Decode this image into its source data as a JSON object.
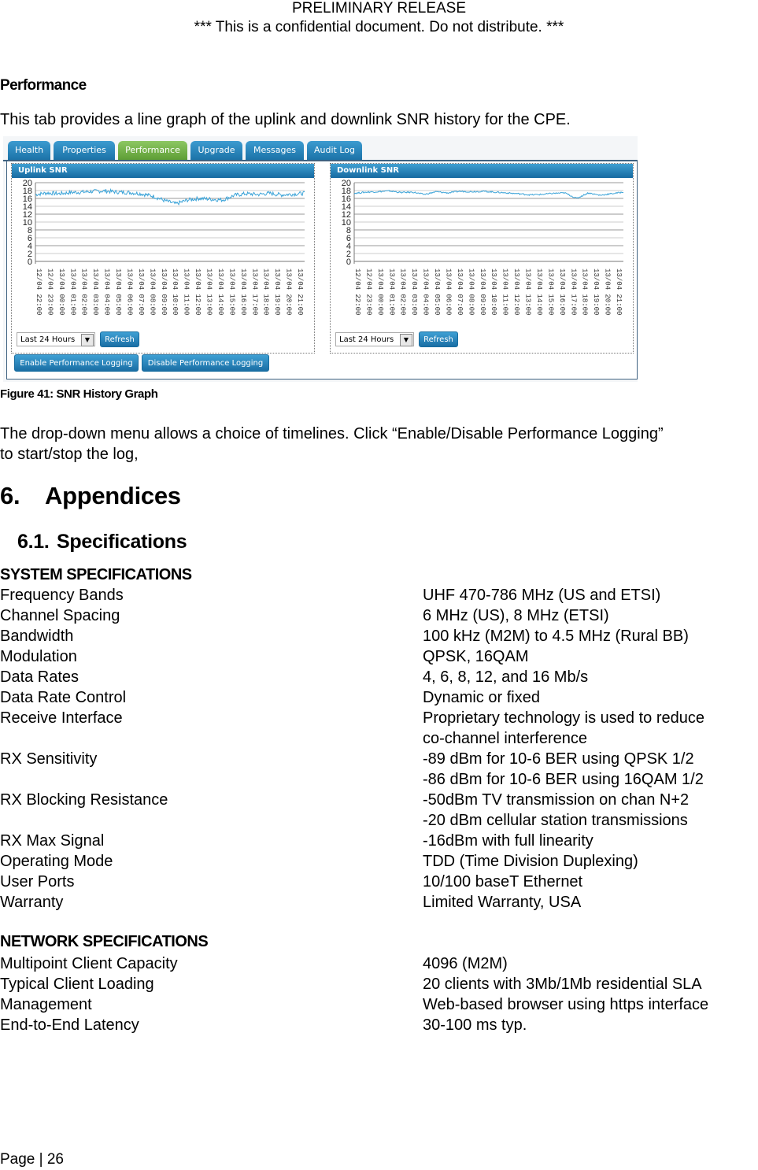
{
  "page_header": {
    "line1": "PRELIMINARY RELEASE",
    "line2": "*** This is a confidential document. Do not distribute. ***"
  },
  "performance": {
    "heading": "Performance",
    "intro": "This tab provides a line graph of the uplink and downlink SNR history for the CPE."
  },
  "screenshot": {
    "tabs": [
      {
        "label": "Health",
        "active": false
      },
      {
        "label": "Properties",
        "active": false
      },
      {
        "label": "Performance",
        "active": true
      },
      {
        "label": "Upgrade",
        "active": false
      },
      {
        "label": "Messages",
        "active": false
      },
      {
        "label": "Audit Log",
        "active": false
      }
    ],
    "panels": [
      {
        "title": "Uplink SNR",
        "range_select": "Last 24 Hours",
        "refresh_label": "Refresh"
      },
      {
        "title": "Downlink SNR",
        "range_select": "Last 24 Hours",
        "refresh_label": "Refresh"
      }
    ],
    "enable_logging_label": "Enable Performance Logging",
    "disable_logging_label": "Disable Performance Logging",
    "colors": {
      "tab_blue": "#1c73a8",
      "tab_active_green": "#5e9e35",
      "series_line": "#3aa3d8"
    }
  },
  "chart_data": [
    {
      "type": "line",
      "title": "Uplink SNR",
      "xlabel": "",
      "ylabel": "",
      "ylim": [
        0,
        20
      ],
      "yticks": [
        0,
        2,
        4,
        6,
        8,
        10,
        12,
        14,
        16,
        18,
        20
      ],
      "grid": true,
      "x": [
        "12/04 22:00",
        "12/04 23:00",
        "13/04 00:00",
        "13/04 01:00",
        "13/04 02:00",
        "13/04 03:00",
        "13/04 04:00",
        "13/04 05:00",
        "13/04 06:00",
        "13/04 07:00",
        "13/04 08:00",
        "13/04 09:00",
        "13/04 10:00",
        "13/04 11:00",
        "13/04 12:00",
        "13/04 13:00",
        "13/04 14:00",
        "13/04 15:00",
        "13/04 16:00",
        "13/04 17:00",
        "13/04 18:00",
        "13/04 19:00",
        "13/04 20:00",
        "13/04 21:00"
      ],
      "series": [
        {
          "name": "Uplink SNR",
          "values": [
            17.0,
            17.4,
            17.2,
            17.5,
            17.6,
            17.8,
            17.9,
            17.6,
            17.5,
            17.2,
            16.6,
            15.5,
            14.6,
            15.6,
            16.0,
            15.8,
            15.6,
            16.8,
            17.2,
            17.0,
            17.3,
            16.9,
            17.1,
            17.3
          ]
        }
      ]
    },
    {
      "type": "line",
      "title": "Downlink SNR",
      "xlabel": "",
      "ylabel": "",
      "ylim": [
        0,
        20
      ],
      "yticks": [
        0,
        2,
        4,
        6,
        8,
        10,
        12,
        14,
        16,
        18,
        20
      ],
      "grid": true,
      "x": [
        "12/04 22:00",
        "12/04 23:00",
        "13/04 00:00",
        "13/04 01:00",
        "13/04 02:00",
        "13/04 03:00",
        "13/04 04:00",
        "13/04 05:00",
        "13/04 06:00",
        "13/04 07:00",
        "13/04 08:00",
        "13/04 09:00",
        "13/04 10:00",
        "13/04 11:00",
        "13/04 12:00",
        "13/04 13:00",
        "13/04 14:00",
        "13/04 15:00",
        "13/04 16:00",
        "13/04 17:00",
        "13/04 18:00",
        "13/04 19:00",
        "13/04 20:00",
        "13/04 21:00"
      ],
      "series": [
        {
          "name": "Downlink SNR",
          "values": [
            17.3,
            17.6,
            17.7,
            17.9,
            17.5,
            17.6,
            17.0,
            17.7,
            17.4,
            17.8,
            17.7,
            17.8,
            17.6,
            17.4,
            17.2,
            16.9,
            17.0,
            17.3,
            17.4,
            16.0,
            17.4,
            16.8,
            17.2,
            17.6
          ]
        }
      ]
    }
  ],
  "figure_caption": "Figure 41: SNR History Graph",
  "description": {
    "line1": "The drop-down menu allows a choice of timelines. Click “Enable/Disable Performance Logging”",
    "line2": "to start/stop the log,"
  },
  "appendices": {
    "number": "6.",
    "title": "Appendices"
  },
  "specifications": {
    "number": "6.1.",
    "title": "Specifications"
  },
  "system_specs": {
    "title": "SYSTEM SPECIFICATIONS",
    "rows": [
      {
        "key": "Frequency Bands",
        "value": "UHF 470-786 MHz (US and ETSI)"
      },
      {
        "key": "Channel Spacing",
        "value": "6 MHz (US), 8 MHz (ETSI)"
      },
      {
        "key": "Bandwidth",
        "value": "100 kHz (M2M) to 4.5 MHz (Rural BB)"
      },
      {
        "key": "Modulation",
        "value": "QPSK, 16QAM"
      },
      {
        "key": "Data Rates",
        "value": "4, 6, 8, 12, and 16 Mb/s"
      },
      {
        "key": "Data Rate Control",
        "value": "Dynamic or fixed"
      },
      {
        "key": "Receive Interface",
        "value": "Proprietary technology is used to reduce\nco-channel interference"
      },
      {
        "key": "RX Sensitivity",
        "value": "-89 dBm for 10-6 BER using QPSK 1/2\n-86 dBm for 10-6 BER using 16QAM 1/2"
      },
      {
        "key": "RX Blocking Resistance",
        "value": "-50dBm TV transmission on chan N+2\n-20 dBm cellular station transmissions"
      },
      {
        "key": "RX Max Signal",
        "value": "-16dBm with full linearity"
      },
      {
        "key": "Operating Mode",
        "value": "TDD (Time Division Duplexing)"
      },
      {
        "key": "User Ports",
        "value": "10/100 baseT Ethernet"
      },
      {
        "key": "Warranty",
        "value": "Limited Warranty, USA"
      }
    ]
  },
  "network_specs": {
    "title": "NETWORK SPECIFICATIONS",
    "rows": [
      {
        "key": "Multipoint Client Capacity",
        "value": "4096 (M2M)"
      },
      {
        "key": "Typical Client Loading",
        "value": "20 clients with 3Mb/1Mb residential SLA"
      },
      {
        "key": "Management",
        "value": "Web-based browser using https interface"
      },
      {
        "key": "End-to-End Latency",
        "value": "30-100 ms typ."
      }
    ]
  },
  "footer": {
    "page_label": "Page | 26"
  }
}
